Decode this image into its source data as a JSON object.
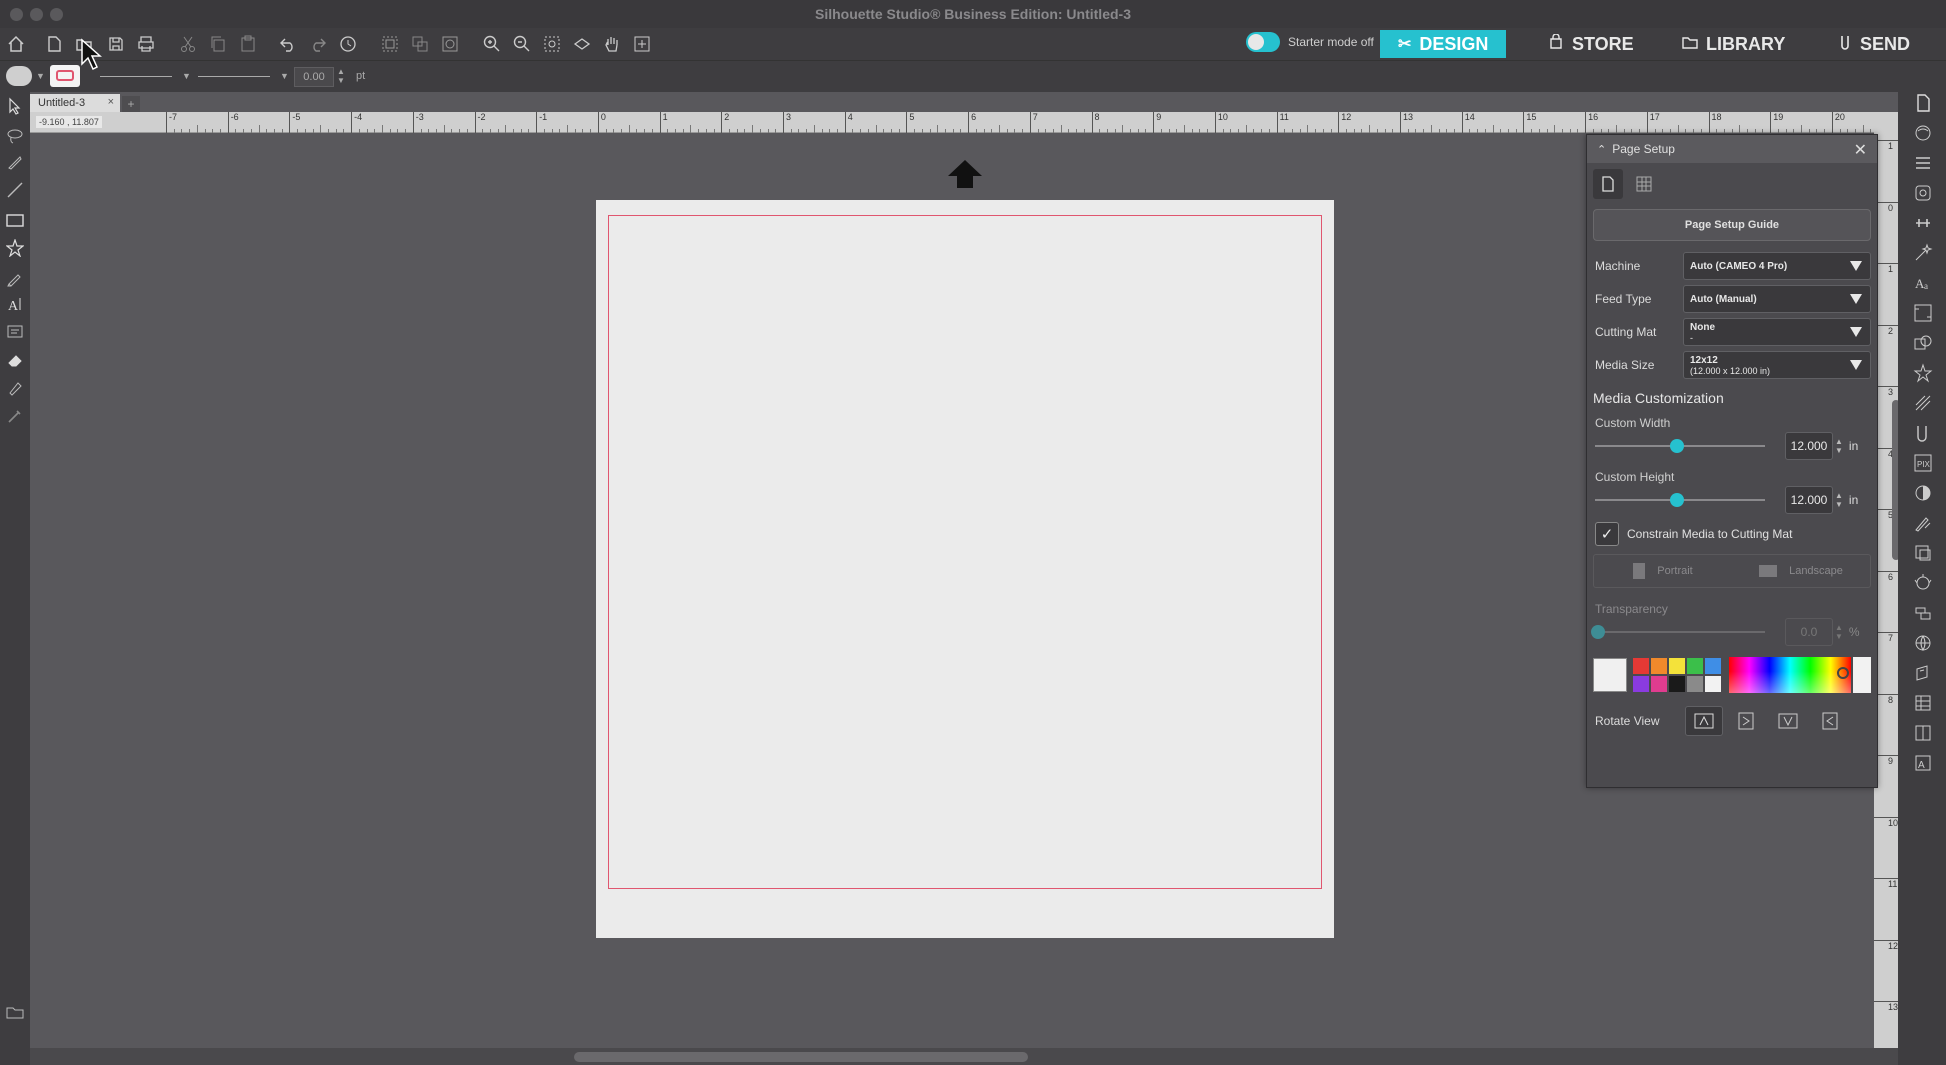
{
  "window": {
    "title": "Silhouette Studio® Business Edition: Untitled-3"
  },
  "nav": {
    "starter_mode": "Starter mode off",
    "design": "DESIGN",
    "store": "STORE",
    "library": "LIBRARY",
    "send": "SEND"
  },
  "subbar": {
    "line_width": "0.00",
    "line_unit": "pt"
  },
  "document": {
    "tab_name": "Untitled-3",
    "tab_close": "×",
    "add_tab": "+",
    "coords": "-9.160 , 11.807"
  },
  "ruler": {
    "h_labels": [
      "-7",
      "-6",
      "-5",
      "-4",
      "-3",
      "-2",
      "-1",
      "0",
      "1",
      "2",
      "3",
      "4",
      "5",
      "6",
      "7",
      "8",
      "9",
      "10",
      "11",
      "12",
      "13",
      "14",
      "15",
      "16",
      "17",
      "18",
      "19",
      "20"
    ],
    "v_labels": [
      "1",
      "0",
      "1",
      "2",
      "3",
      "4",
      "5",
      "6",
      "7",
      "8",
      "9",
      "10",
      "11",
      "12",
      "13"
    ]
  },
  "panel": {
    "title": "Page Setup",
    "guide_button": "Page Setup Guide",
    "machine_label": "Machine",
    "machine_value": "Auto (CAMEO 4 Pro)",
    "feed_label": "Feed Type",
    "feed_value": "Auto (Manual)",
    "mat_label": "Cutting Mat",
    "mat_value": "None",
    "mat_sub": "-",
    "size_label": "Media Size",
    "size_value": "12x12",
    "size_sub": "(12.000 x 12.000 in)",
    "customization_title": "Media Customization",
    "width_label": "Custom Width",
    "width_value": "12.000",
    "width_unit": "in",
    "width_level": 0.48,
    "height_label": "Custom Height",
    "height_value": "12.000",
    "height_unit": "in",
    "height_level": 0.48,
    "constrain_label": "Constrain Media to Cutting Mat",
    "portrait": "Portrait",
    "landscape": "Landscape",
    "transparency_label": "Transparency",
    "transparency_value": "0.0",
    "transparency_unit": "%",
    "rotate_label": "Rotate View"
  },
  "colors": {
    "accent": "#26c1cf",
    "cut_border": "#e0566f",
    "swatches": [
      "#e53935",
      "#f0892b",
      "#f4e23a",
      "#3bbf4a",
      "#3f8ee6",
      "#8a3be0",
      "#e03c8f",
      "#1a1a1a",
      "#8a8a8a",
      "#f2f2f2"
    ]
  }
}
